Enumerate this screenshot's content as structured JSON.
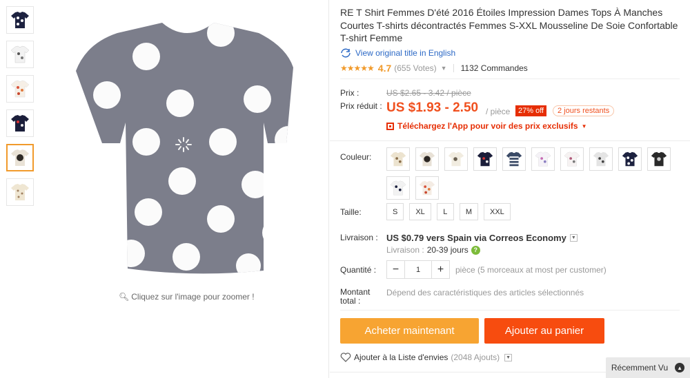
{
  "product": {
    "title": "RE T Shirt Femmes D'été 2016 Étoiles Impression Dames Tops À Manches Courtes T-shirts décontractés Femmes S-XXL Mousseline De Soie Confortable T-shirt Femme",
    "translate_link": "View original title in English",
    "stars": "★★★★★",
    "rating": "4.7",
    "votes": "(655 Votes)",
    "orders": "1132 Commandes",
    "zoom_hint": "Cliquez sur l'image pour zoomer !"
  },
  "pricing": {
    "price_label": "Prix :",
    "old_price": "US $2.65 - 3.42 / pièce",
    "discount_price_label": "Prix réduit :",
    "price": "US $1.93 - 2.50",
    "unit": "/ pièce",
    "discount": "27% off",
    "days_left": "2 jours restants",
    "app_promo": "Téléchargez l'App pour voir des prix exclusifs"
  },
  "options": {
    "color_label": "Couleur:",
    "size_label": "Taille:",
    "sizes": [
      "S",
      "XL",
      "L",
      "M",
      "XXL"
    ],
    "shipping_label": "Livraison :",
    "shipping": "US $0.79 vers Spain via Correos Economy",
    "shipping_time_label": "Livraison :",
    "shipping_time": "20-39 jours",
    "qty_label": "Quantité :",
    "qty_value": "1",
    "qty_minus": "−",
    "qty_plus": "+",
    "qty_note": "pièce (5 morceaux at most per customer)",
    "total_label": "Montant total :",
    "total_note": "Dépend des caractéristiques des articles sélectionnés"
  },
  "actions": {
    "buy_now": "Acheter maintenant",
    "add_to_cart": "Ajouter au panier",
    "wishlist": "Ajouter à la Liste d'envies",
    "wishlist_count": "(2048 Ajouts)",
    "recently_viewed": "Récemment Vu"
  },
  "colors": {
    "accent": "#f0501e",
    "buy": "#f7a432",
    "cart": "#f74c0f",
    "link": "#2b68c5"
  }
}
